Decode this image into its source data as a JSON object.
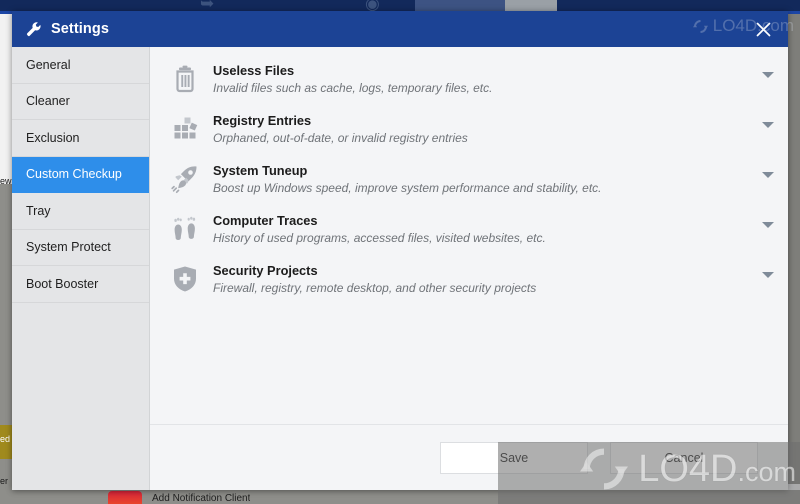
{
  "window": {
    "title": "Settings",
    "title_icon": "wrench-icon",
    "close_icon": "close-icon",
    "titlebar_color": "#1c4395"
  },
  "sidebar": {
    "accent_color": "#2e8eea",
    "items": [
      {
        "label": "General",
        "active": false
      },
      {
        "label": "Cleaner",
        "active": false
      },
      {
        "label": "Exclusion",
        "active": false
      },
      {
        "label": "Custom Checkup",
        "active": true
      },
      {
        "label": "Tray",
        "active": false
      },
      {
        "label": "System Protect",
        "active": false
      },
      {
        "label": "Boot Booster",
        "active": false
      }
    ]
  },
  "main": {
    "rows": [
      {
        "icon": "trash-icon",
        "title": "Useless Files",
        "description": "Invalid files such as cache, logs, temporary files, etc.",
        "chevron": "chevron-down-icon"
      },
      {
        "icon": "registry-blocks-icon",
        "title": "Registry Entries",
        "description": "Orphaned, out-of-date, or invalid registry entries",
        "chevron": "chevron-down-icon"
      },
      {
        "icon": "rocket-icon",
        "title": "System Tuneup",
        "description": "Boost up Windows speed, improve system performance and stability, etc.",
        "chevron": "chevron-down-icon"
      },
      {
        "icon": "footprints-icon",
        "title": "Computer Traces",
        "description": "History of used programs, accessed files, visited websites, etc.",
        "chevron": "chevron-down-icon"
      },
      {
        "icon": "shield-plus-icon",
        "title": "Security Projects",
        "description": "Firewall, registry, remote desktop, and other security projects",
        "chevron": "chevron-down-icon"
      }
    ]
  },
  "footer": {
    "save_label": "Save",
    "cancel_label": "Cancel"
  },
  "watermark": {
    "text_main": "LO4D",
    "text_suffix": ".com",
    "logo_icon": "refresh-circle-icon"
  },
  "background": {
    "left_label_1": "ew",
    "left_label_2": "ed",
    "left_label_3": "er",
    "bottom_label": "Add Notification Client"
  }
}
